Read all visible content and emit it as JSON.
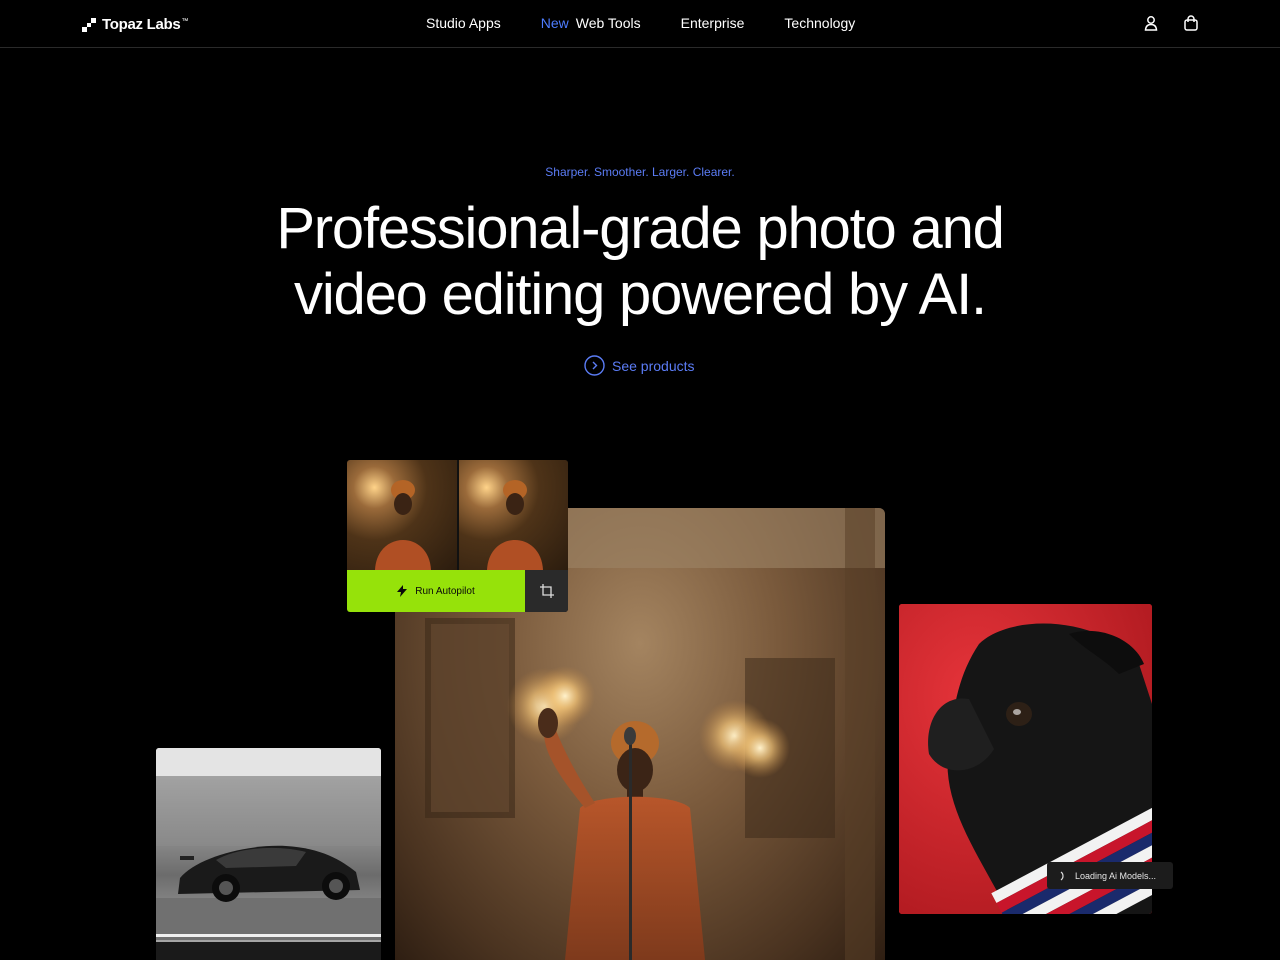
{
  "nav": {
    "logo": "Topaz Labs",
    "logo_tm": "™",
    "links": [
      {
        "label": "Studio Apps",
        "badge": ""
      },
      {
        "label": "Web Tools",
        "badge": "New"
      },
      {
        "label": "Enterprise",
        "badge": ""
      },
      {
        "label": "Technology",
        "badge": ""
      }
    ],
    "icons": [
      "user-icon",
      "shopping-bag-icon"
    ]
  },
  "hero": {
    "eyebrow": "Sharper. Smoother. Larger. Clearer.",
    "headline_line1": "Professional-grade photo and",
    "headline_line2": "video editing powered by AI.",
    "cta_label": "See products",
    "cta_icon": "chevron-circle-right-icon"
  },
  "demo": {
    "run_button_label": "Run Autopilot",
    "run_button_icon": "lightning-icon",
    "crop_icon": "crop-icon",
    "loading_label": "Loading Ai Models...",
    "loading_icon": "spinner-icon"
  },
  "colors": {
    "background": "#000000",
    "accent_blue": "#5b7cf5",
    "autopilot_green": "#96e20a",
    "dog_background_red": "#d8262b"
  }
}
